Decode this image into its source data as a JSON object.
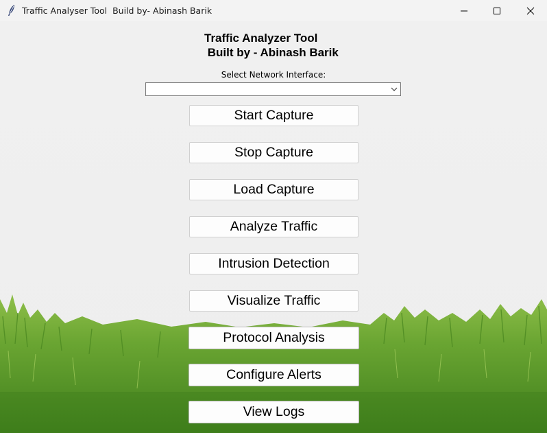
{
  "window": {
    "title": "Traffic Analyser Tool  Build by- Abinash Barik",
    "icon": "feather-icon",
    "controls": [
      "minimize-icon",
      "maximize-icon",
      "close-icon"
    ]
  },
  "header": {
    "line1": "Traffic Analyzer Tool",
    "line2": " Built by - Abinash Barik"
  },
  "interface": {
    "label": "Select Network Interface:",
    "selected": ""
  },
  "buttons": {
    "start": "Start Capture",
    "stop": "Stop Capture",
    "load": "Load Capture",
    "analyze": "Analyze Traffic",
    "intrusion": "Intrusion Detection",
    "visualize": "Visualize Traffic",
    "protocol": "Protocol Analysis",
    "alerts": "Configure Alerts",
    "logs": "View Logs"
  },
  "colors": {
    "background": "#f0f0f0",
    "grass": "#5a9a2a"
  }
}
